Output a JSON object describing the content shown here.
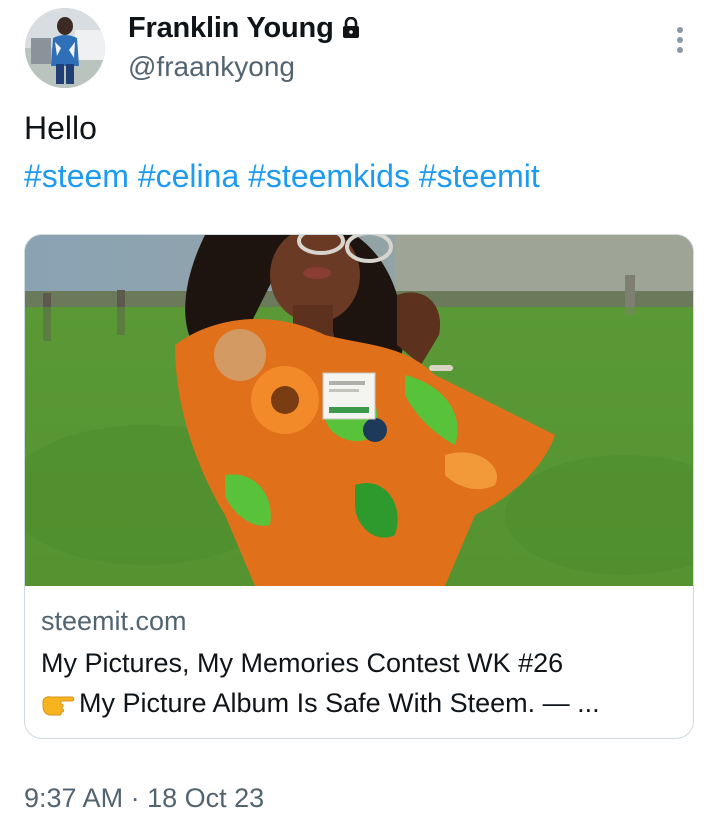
{
  "author": {
    "display_name": "Franklin Young",
    "handle": "@fraankyong",
    "avatar_icon": "profile-photo",
    "protected_icon": "lock-icon"
  },
  "tweet": {
    "text": "Hello",
    "hashtags": [
      "#steem",
      "#celina",
      "#steemkids",
      "#steemit"
    ]
  },
  "card": {
    "image_icon": "photo-woman-in-orange-dress",
    "domain": "steemit.com",
    "title_line1": "My Pictures, My Memories Contest WK #26",
    "title_line2": "My Picture Album Is Safe With Steem. — ...",
    "title_emoji_icon": "backhand-index-pointing-right-icon"
  },
  "timestamp": {
    "time": "9:37 AM",
    "separator": " · ",
    "date": "18 Oct 23"
  },
  "colors": {
    "link": "#1d9bf0",
    "secondary_text": "#536471",
    "primary_text": "#0f1419",
    "border": "#cfd9de"
  }
}
